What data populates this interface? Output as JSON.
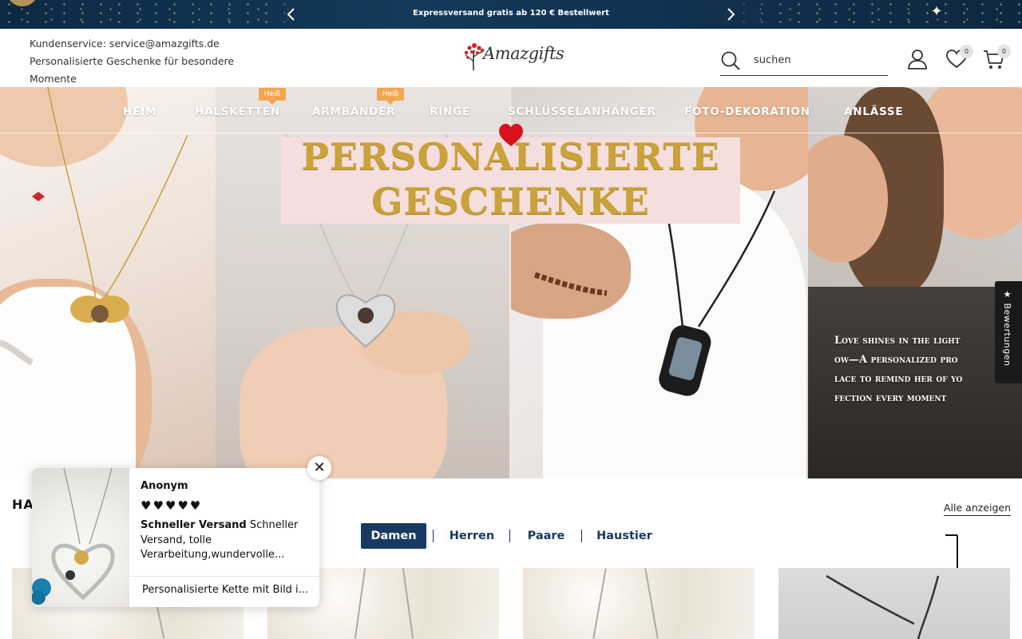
{
  "promo": {
    "text": "Expressversand gratis ab 120 € Bestellwert",
    "prev_icon": "chevron-left-icon",
    "next_icon": "chevron-right-icon"
  },
  "header": {
    "service_line": "Kundenservice: service@amazgifts.de",
    "tagline": "Personalisierte Geschenke für besondere Momente",
    "logo_text": "Amazgifts",
    "search_placeholder": "suchen",
    "wishlist_count": "0",
    "cart_count": "0"
  },
  "nav": {
    "items": [
      {
        "label": "HEIM"
      },
      {
        "label": "HALSKETTEN",
        "badge": "Heiß"
      },
      {
        "label": "ARMBÄNDER",
        "badge": "Heiß"
      },
      {
        "label": "RINGE"
      },
      {
        "label": "SCHLÜSSELANHÄNGER"
      },
      {
        "label": "FOTO-DEKORATION"
      },
      {
        "label": "ANLÄSSE"
      }
    ]
  },
  "hero": {
    "headline_1": "PERSONALISIERTE",
    "headline_2": "GESCHENKE",
    "overlay_lines": [
      "Love shines in the light",
      "ow—A personalized pro",
      "lace to remind her of yo",
      "fection every moment"
    ]
  },
  "section": {
    "title": "HA",
    "view_all": "Alle anzeigen",
    "tabs": [
      {
        "label": "Damen",
        "active": true
      },
      {
        "label": "Herren",
        "active": false
      },
      {
        "label": "Paare",
        "active": false
      },
      {
        "label": "Haustier",
        "active": false
      }
    ]
  },
  "review_popup": {
    "name": "Anonym",
    "rating": 5,
    "hearts": "♥♥♥♥♥",
    "review_bold": "Schneller Versand",
    "review_text": "Schneller Versand, tolle Verarbeitung,wundervolle...",
    "product": "Personalisierte Kette mit Bild i...",
    "close_icon": "close-icon"
  },
  "side_tab": {
    "label": "★ Bewertungen"
  },
  "colors": {
    "promo_bg": "#0f3150",
    "tab_active": "#173a62",
    "hot_badge": "#f2a650",
    "headline_gold": "#c9a23a"
  }
}
